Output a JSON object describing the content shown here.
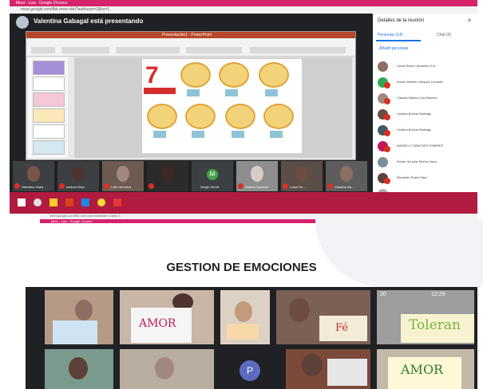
{
  "browser_top": {
    "title": "Meet - Lwa · Google Chrome",
    "url": "meet.google.com/fbk-mxre-dvh?authuser=2&hs=1"
  },
  "presenter_banner": "Valentina Gabagal está presentando",
  "ppt": {
    "title": "Presentación1 - PowerPoint"
  },
  "slide": {
    "number": "7"
  },
  "panel": {
    "heading": "Detalles de la reunión",
    "close": "✕",
    "tab_people": "Personas (14)",
    "tab_chat": "Chat (0)",
    "add_people": "Añadir personas",
    "participants": [
      "Laura Rivera Jaramillo (Tú)",
      "Anuar Niebles Vásquez Londoño",
      "Claudia Milena Cruz Benítez",
      "Cristina Bolívar Buitrago",
      "Cristina Bolívar Buitrago",
      "DANIELLY SANCHEZ RAMIREZ",
      "Esther del pilar Muñoz Vaca",
      "Elizabeth Rubio Sáez",
      "Nora Susana Chávez Lozano"
    ]
  },
  "strip": [
    "Valentina Gaba…",
    "Andrea Silva",
    "Lulia Verónica",
    "Sergio SILVA",
    "Andrea Sánchez",
    "Luisa Fer…",
    "Catalina Var…"
  ],
  "strip_letter_tile": "M",
  "browser_bottom": {
    "title": "Meet - Lwa · Google Chrome",
    "url": "meet.google.com/fbk-mxre-dvh?authuser=2&hs=1"
  },
  "heading": "GESTION DE EMOCIONES",
  "grid": {
    "status": "20",
    "time": "12:29",
    "letter": "P",
    "signs": [
      "AMOR",
      "Toleran",
      "Fé",
      "AMOR"
    ]
  },
  "colors": {
    "meet_red": "#d6236b",
    "taskbar": "#b01b3f",
    "accent_blue": "#1a73e8"
  }
}
